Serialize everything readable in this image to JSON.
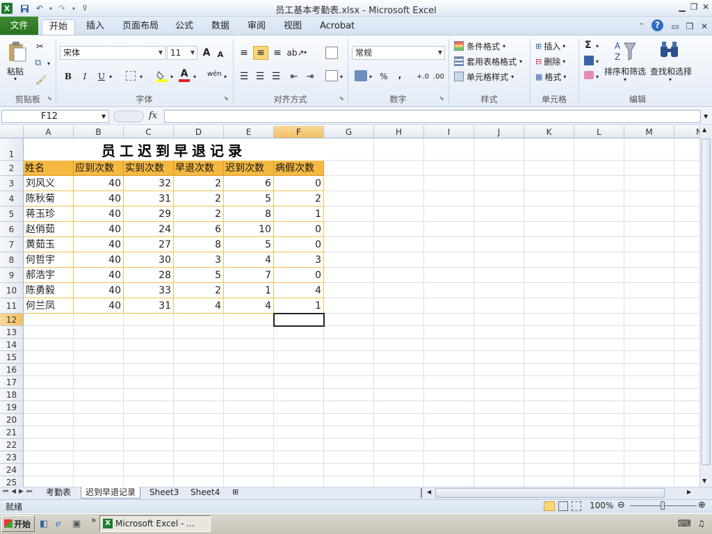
{
  "window": {
    "title": "员工基本考勤表.xlsx - Microsoft Excel",
    "app_icon": "excel-icon"
  },
  "ribbon_tabs": [
    "文件",
    "开始",
    "插入",
    "页面布局",
    "公式",
    "数据",
    "审阅",
    "视图",
    "Acrobat"
  ],
  "ribbon": {
    "clipboard": {
      "paste": "粘贴",
      "group": "剪贴板"
    },
    "font": {
      "name": "宋体",
      "size": "11",
      "group": "字体",
      "bold": "B",
      "italic": "I",
      "underline": "U",
      "grow": "A",
      "shrink": "A",
      "color_letter": "A",
      "phonetic": "wén"
    },
    "alignment": {
      "group": "对齐方式"
    },
    "number": {
      "format": "常规",
      "group": "数字",
      "percent": "%",
      "comma": ","
    },
    "styles": {
      "conditional": "条件格式",
      "table": "套用表格格式",
      "cell": "单元格样式",
      "group": "样式"
    },
    "cells": {
      "insert": "插入",
      "delete": "删除",
      "format": "格式",
      "group": "单元格"
    },
    "editing": {
      "sum": "Σ",
      "sort": "排序和筛选",
      "find": "查找和选择",
      "group": "编辑"
    }
  },
  "formula_bar": {
    "name_box": "F12",
    "fx": "fx",
    "formula": ""
  },
  "columns": [
    "A",
    "B",
    "C",
    "D",
    "E",
    "F",
    "G",
    "H",
    "I",
    "J",
    "K",
    "L",
    "M",
    "N"
  ],
  "selected_column": "F",
  "selected_row": 12,
  "sheet": {
    "title": "员工迟到早退记录",
    "headers": [
      "姓名",
      "应到次数",
      "实到次数",
      "早退次数",
      "迟到次数",
      "病假次数"
    ],
    "rows": [
      [
        "刘风义",
        "40",
        "32",
        "2",
        "6",
        "0"
      ],
      [
        "陈秋菊",
        "40",
        "31",
        "2",
        "5",
        "2"
      ],
      [
        "蒋玉珍",
        "40",
        "29",
        "2",
        "8",
        "1"
      ],
      [
        "赵俏茹",
        "40",
        "24",
        "6",
        "10",
        "0"
      ],
      [
        "黄茹玉",
        "40",
        "27",
        "8",
        "5",
        "0"
      ],
      [
        "何哲宇",
        "40",
        "30",
        "3",
        "4",
        "3"
      ],
      [
        "郝浩宇",
        "40",
        "28",
        "5",
        "7",
        "0"
      ],
      [
        "陈勇毅",
        "40",
        "33",
        "2",
        "1",
        "4"
      ],
      [
        "何兰凤",
        "40",
        "31",
        "4",
        "4",
        "1"
      ]
    ]
  },
  "sheet_tabs": [
    "考勤表",
    "迟到早退记录",
    "Sheet3",
    "Sheet4"
  ],
  "active_sheet": "迟到早退记录",
  "status": {
    "ready": "就绪",
    "zoom": "100%"
  },
  "taskbar": {
    "start": "开始",
    "task": "Microsoft Excel - ..."
  },
  "colors": {
    "header_fill": "#f5b942",
    "accent": "#2a7020",
    "selection": "#f2c061"
  }
}
